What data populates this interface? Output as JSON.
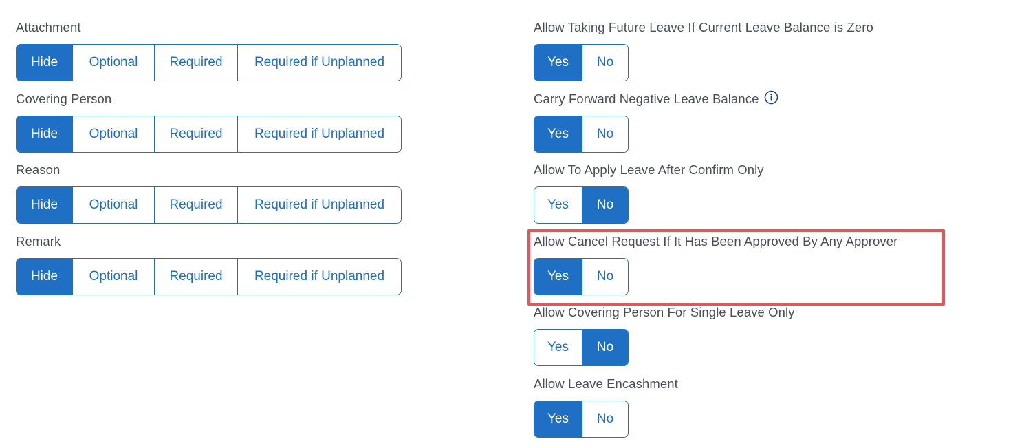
{
  "left_fields": [
    {
      "label": "Attachment",
      "options": [
        "Hide",
        "Optional",
        "Required",
        "Required if Unplanned"
      ],
      "selected": "Hide"
    },
    {
      "label": "Covering Person",
      "options": [
        "Hide",
        "Optional",
        "Required",
        "Required if Unplanned"
      ],
      "selected": "Hide"
    },
    {
      "label": "Reason",
      "options": [
        "Hide",
        "Optional",
        "Required",
        "Required if Unplanned"
      ],
      "selected": "Hide"
    },
    {
      "label": "Remark",
      "options": [
        "Hide",
        "Optional",
        "Required",
        "Required if Unplanned"
      ],
      "selected": "Hide"
    }
  ],
  "right_fields": [
    {
      "label": "Allow Taking Future Leave If Current Leave Balance is Zero",
      "yes": "Yes",
      "no": "No",
      "selected": "Yes"
    },
    {
      "label": "Carry Forward Negative Leave Balance",
      "yes": "Yes",
      "no": "No",
      "selected": "Yes",
      "info_icon": "info-circle-icon"
    },
    {
      "label": "Allow To Apply Leave After Confirm Only",
      "yes": "Yes",
      "no": "No",
      "selected": "No"
    },
    {
      "label": "Allow Cancel Request If It Has Been Approved By Any Approver",
      "yes": "Yes",
      "no": "No",
      "selected": "Yes",
      "highlighted": true
    },
    {
      "label": "Allow Covering Person For Single Leave Only",
      "yes": "Yes",
      "no": "No",
      "selected": "No"
    },
    {
      "label": "Allow Leave Encashment",
      "yes": "Yes",
      "no": "No",
      "selected": "Yes"
    }
  ],
  "colors": {
    "accent": "#1f6fc5",
    "label": "#4a4f57",
    "highlight": "#e8545a"
  }
}
